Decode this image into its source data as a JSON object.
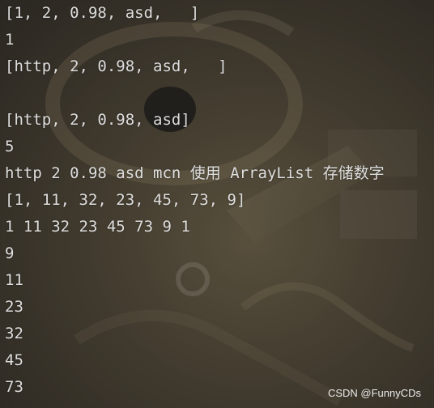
{
  "console": {
    "lines": [
      "[1, 2, 0.98, asd,   ]",
      "1",
      "[http, 2, 0.98, asd,   ]",
      "",
      "[http, 2, 0.98, asd]",
      "5",
      "http 2 0.98 asd mcn 使用 ArrayList 存储数字",
      "[1, 11, 32, 23, 45, 73, 9]",
      "1 11 32 23 45 73 9 1",
      "9",
      "11",
      "23",
      "32",
      "45",
      "73"
    ]
  },
  "watermark": "CSDN @FunnyCDs",
  "colors": {
    "text": "#dedede",
    "background": "#3f3a31"
  }
}
